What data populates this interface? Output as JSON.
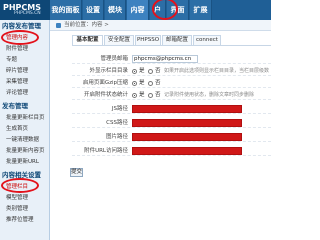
{
  "app": {
    "logo_main": "PHPCMS",
    "logo_sub": "PHPCMS.CN",
    "nav": [
      "我的面板",
      "设置",
      "模块",
      "内容",
      "户",
      "界面",
      "扩展"
    ]
  },
  "sidebar": {
    "groups": [
      {
        "title": "内容发布管理",
        "items": [
          "管理内容",
          "附件管理",
          "专题",
          "碎片管理",
          "采集管理",
          "评论管理"
        ]
      },
      {
        "title": "发布管理",
        "items": [
          "批量更新栏目页",
          "生成首页",
          "一键清理数据",
          "批量更新内容页",
          "批量更新URL"
        ]
      },
      {
        "title": "内容相关设置",
        "items": [
          "管理栏目",
          "模型管理",
          "类别管理",
          "推荐位管理"
        ]
      }
    ]
  },
  "breadcrumb": "当前位置：内容 >",
  "tabs": [
    "基本配置",
    "安全配置",
    "PHPSSO",
    "邮箱配置",
    "connect"
  ],
  "form": {
    "admin_email_label": "管理员邮箱",
    "admin_email_value": "phpcms@phpcms.cn",
    "catdir_label": "外显示栏目目录",
    "catdir_option_yes": "是",
    "catdir_option_no": "否",
    "catdir_hint": "如果开启此选项则显示栏目目录，当栏目层级数量较多时可关闭",
    "gzip_label": "启用页面Gzip压缩",
    "gzip_option_yes": "是",
    "gzip_option_no": "否",
    "attach_sync_label": "开启附件状态统计",
    "attach_sync_option_yes": "是",
    "attach_sync_option_no": "否",
    "attach_sync_hint": "记录附件使用状态，删除文章时同步删除",
    "js_path_label": "JS路径",
    "css_path_label": "CSS路径",
    "img_path_label": "图片路径",
    "upload_url_label": "附件URL访问路径",
    "submit_label": "提交"
  },
  "annotation_color": "#e3121b"
}
